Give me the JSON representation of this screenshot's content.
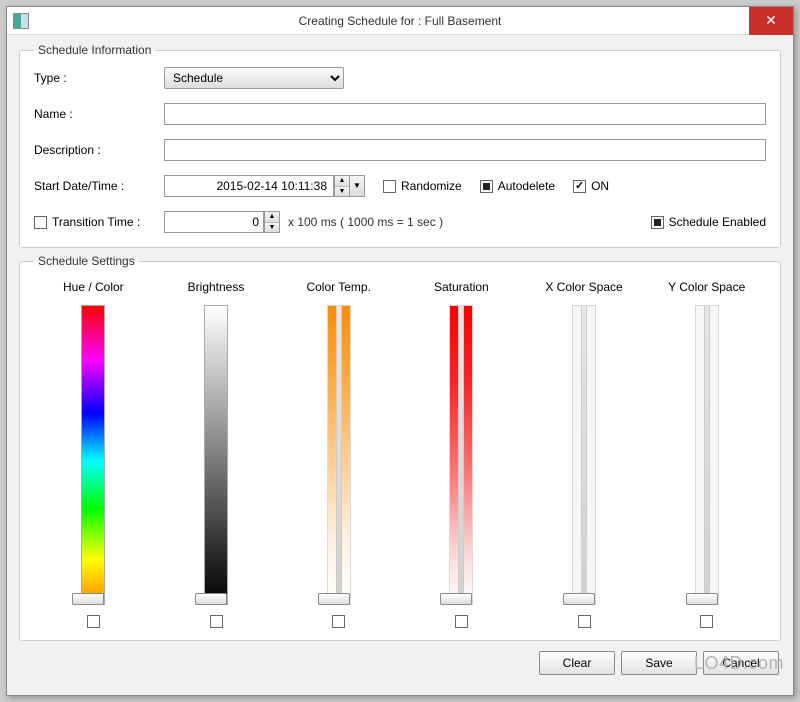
{
  "window": {
    "title": "Creating Schedule for : Full Basement"
  },
  "info": {
    "legend": "Schedule Information",
    "type_label": "Type :",
    "type_value": "Schedule",
    "name_label": "Name :",
    "name_value": "",
    "desc_label": "Description :",
    "desc_value": "",
    "start_label": "Start Date/Time :",
    "start_value": "2015-02-14 10:11:38",
    "randomize_label": "Randomize",
    "autodelete_label": "Autodelete",
    "on_label": "ON",
    "transition_label": "Transition Time :",
    "transition_value": "0",
    "transition_hint": "x 100 ms ( 1000 ms = 1 sec )",
    "schedule_enabled_label": "Schedule Enabled"
  },
  "settings": {
    "legend": "Schedule Settings",
    "cols": {
      "hue": "Hue / Color",
      "brightness": "Brightness",
      "colortemp": "Color Temp.",
      "saturation": "Saturation",
      "xcolor": "X Color Space",
      "ycolor": "Y Color Space"
    }
  },
  "buttons": {
    "clear": "Clear",
    "save": "Save",
    "cancel": "Cancel"
  },
  "watermark": "LO4D.com"
}
